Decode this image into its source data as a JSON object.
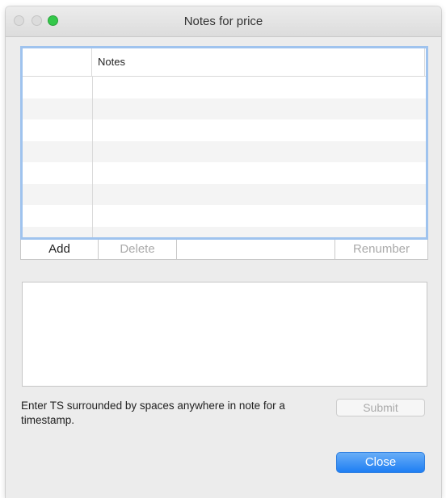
{
  "window": {
    "title": "Notes for price"
  },
  "table": {
    "columns": [
      "",
      "Notes"
    ],
    "rows": [
      "",
      "",
      "",
      "",
      "",
      "",
      "",
      ""
    ]
  },
  "buttons": {
    "add": "Add",
    "delete": "Delete",
    "renumber": "Renumber",
    "submit": "Submit",
    "close": "Close"
  },
  "note_editor": {
    "value": ""
  },
  "hint": "Enter TS surrounded by spaces anywhere in note for a timestamp.",
  "colors": {
    "accent": "#1e7ef3",
    "focus_ring": "#9fc3ee",
    "traffic_green": "#34c84a"
  }
}
